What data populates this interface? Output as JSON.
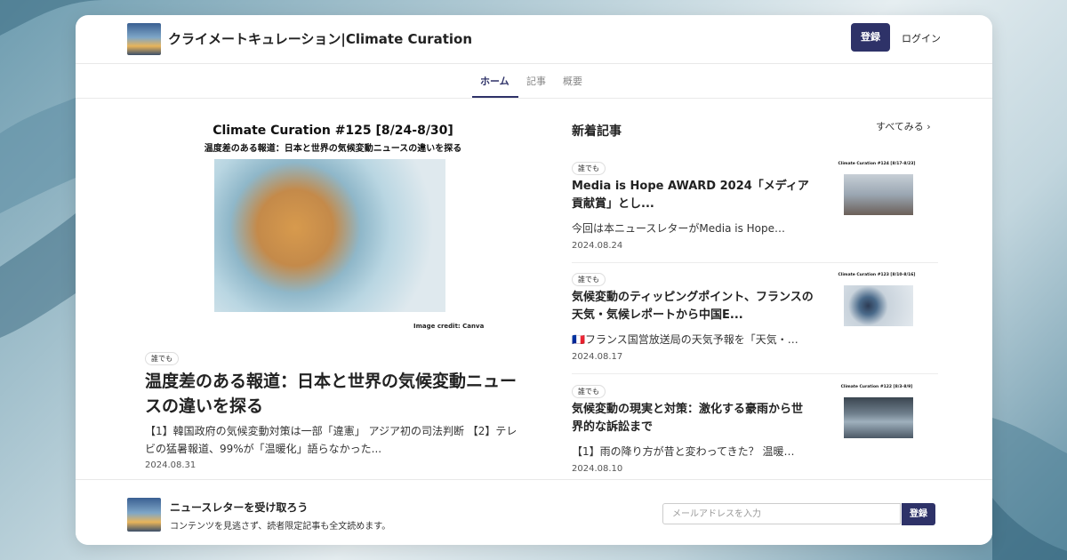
{
  "site": {
    "title": "クライメートキュレーション|Climate Curation"
  },
  "header": {
    "register_label": "登録",
    "login_label": "ログイン"
  },
  "nav": {
    "tabs": [
      {
        "label": "ホーム"
      },
      {
        "label": "記事"
      },
      {
        "label": "概要"
      }
    ]
  },
  "feature": {
    "image_title": "Climate Curation #125 [8/24-8/30]",
    "image_subtitle": "温度差のある報道：日本と世界の気候変動ニュースの違いを探る",
    "image_credit": "Image credit: Canva",
    "badge": "誰でも",
    "title": "温度差のある報道：日本と世界の気候変動ニュースの違いを探る",
    "excerpt": "【1】韓国政府の気候変動対策は一部「違憲」 アジア初の司法判断 【2】テレビの猛暑報道、99%が「温暖化」語らなかった...",
    "date": "2024.08.31"
  },
  "sidebar": {
    "heading": "新着記事",
    "see_all": "すべてみる ›",
    "articles": [
      {
        "badge": "誰でも",
        "title": "Media is Hope AWARD 2024「メディア貢献賞」とし...",
        "excerpt": "今回は本ニュースレターがMedia is Hope…",
        "date": "2024.08.24",
        "thumb_title": "Climate Curation #124 [8/17-8/23]"
      },
      {
        "badge": "誰でも",
        "title": "気候変動のティッピングポイント、フランスの天気・気候レポートから中国E...",
        "excerpt": "🇫🇷フランス国営放送局の天気予報を「天気・…",
        "date": "2024.08.17",
        "thumb_title": "Climate Curation #123 [8/10-8/16]"
      },
      {
        "badge": "誰でも",
        "title": "気候変動の現実と対策：激化する豪雨から世界的な訴訟まで",
        "excerpt": "【1】雨の降り方が昔と変わってきた？ 温暖…",
        "date": "2024.08.10",
        "thumb_title": "Climate Curation #122 [8/3-8/9]"
      }
    ]
  },
  "footer": {
    "title": "ニュースレターを受け取ろう",
    "subtitle": "コンテンツを見逃さず、読者限定記事も全文読めます。",
    "email_placeholder": "メールアドレスを入力",
    "subscribe_label": "登録"
  },
  "colors": {
    "accent": "#2e3268"
  }
}
